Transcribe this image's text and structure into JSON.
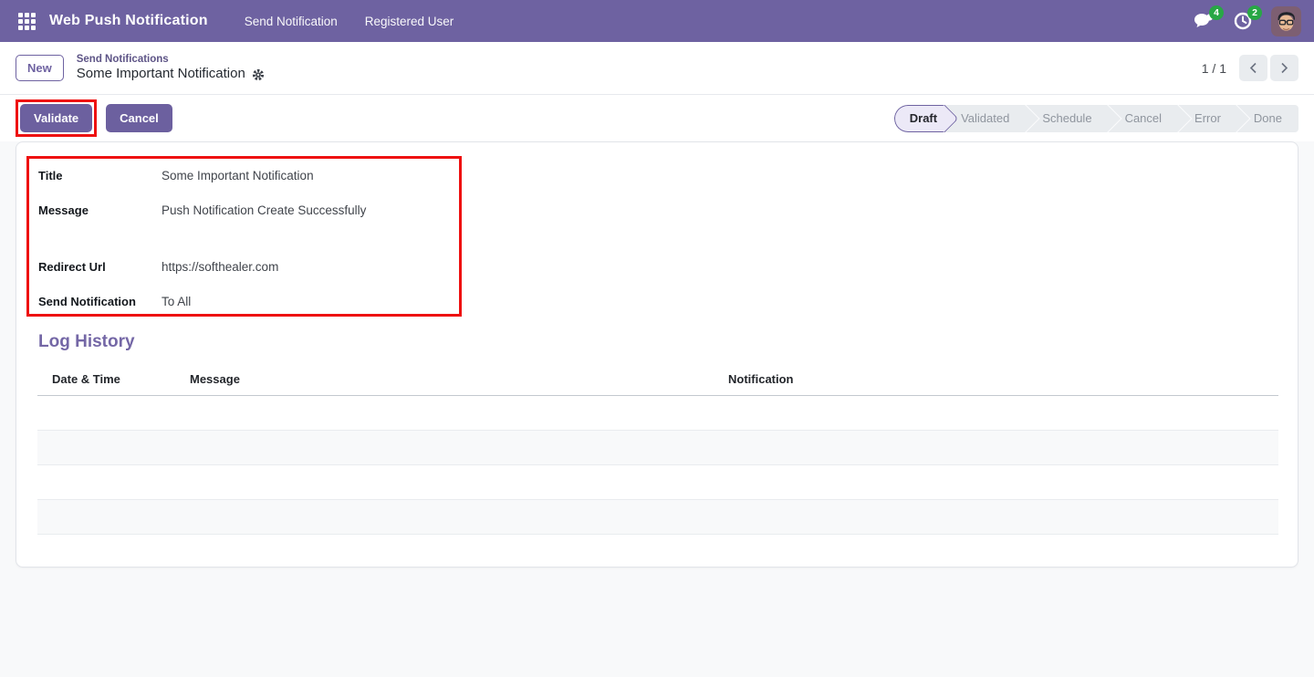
{
  "navbar": {
    "app_title": "Web Push Notification",
    "menu_items": [
      "Send Notification",
      "Registered User"
    ],
    "messages_badge": "4",
    "activities_badge": "2"
  },
  "control_panel": {
    "new_button": "New",
    "breadcrumb": {
      "parent": "Send Notifications",
      "current": "Some Important Notification"
    },
    "pager": "1 / 1"
  },
  "statusbar": {
    "validate_button": "Validate",
    "cancel_button": "Cancel",
    "steps": [
      "Draft",
      "Validated",
      "Schedule",
      "Cancel",
      "Error",
      "Done"
    ],
    "active_step": "Draft"
  },
  "form": {
    "fields": [
      {
        "label": "Title",
        "value": "Some Important Notification"
      },
      {
        "label": "Message",
        "value": "Push Notification Create Successfully"
      },
      {
        "label": "Redirect Url",
        "value": "https://softhealer.com"
      },
      {
        "label": "Send Notification",
        "value": "To All"
      }
    ]
  },
  "log_history": {
    "title": "Log History",
    "columns": [
      "Date & Time",
      "Message",
      "Notification"
    ],
    "rows": []
  },
  "colors": {
    "navbar_bg": "#6e62a1",
    "primary_button": "#6c609f",
    "highlight_red": "#ee1111",
    "badge_green": "#28a745",
    "heading_purple": "#7467a6",
    "active_step_bg": "#ece9f7",
    "statusbar_bg": "#e9ecef",
    "page_bg": "#f8f9fa"
  }
}
